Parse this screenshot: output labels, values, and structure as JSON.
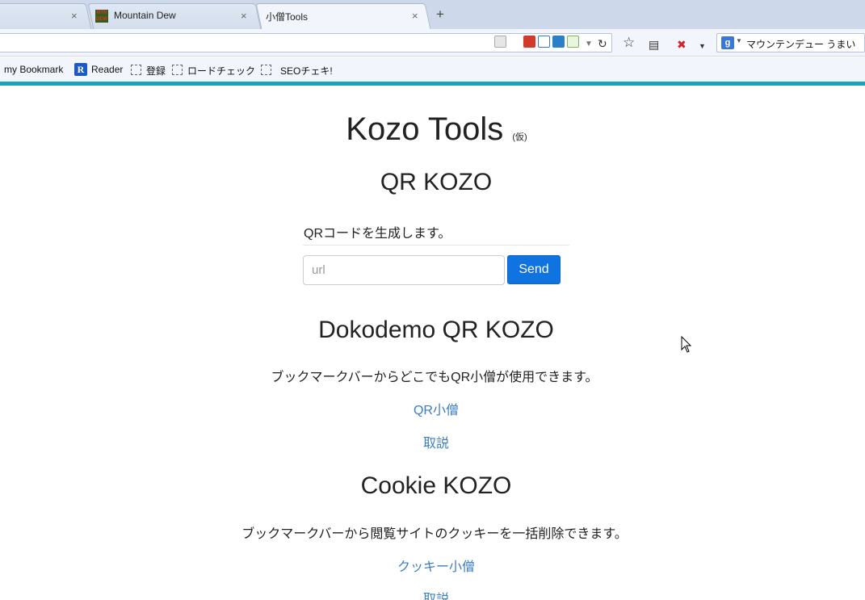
{
  "browser": {
    "tabs": [
      {
        "title": ""
      },
      {
        "title": "Mountain Dew",
        "favicon_text": "MTN DEW"
      },
      {
        "title": "小僧Tools"
      }
    ],
    "new_tab_symbol": "+",
    "close_symbol": "×",
    "search": {
      "engine_icon": "g",
      "query": "マウンテンデュー うまい"
    },
    "bookmarks": [
      {
        "label": "my Bookmark"
      },
      {
        "label": "Reader",
        "icon": "R"
      },
      {
        "label": "登録"
      },
      {
        "label": "ロードチェック"
      },
      {
        "label": "SEOチェキ!"
      }
    ],
    "colors": {
      "accent_bar": "#1f9fc2",
      "chrome": "#cdd9ea"
    }
  },
  "page": {
    "title": "Kozo Tools",
    "title_note": "(仮)",
    "qr": {
      "heading": "QR KOZO",
      "description": "QRコードを生成します。",
      "input_placeholder": "url",
      "send_label": "Send"
    },
    "dokodemo": {
      "heading": "Dokodemo QR KOZO",
      "description": "ブックマークバーからどこでもQR小僧が使用できます。",
      "link_label": "QR小僧",
      "manual_label": "取説"
    },
    "cookie": {
      "heading": "Cookie KOZO",
      "description": "ブックマークバーから閲覧サイトのクッキーを一括削除できます。",
      "link_label": "クッキー小僧",
      "manual_label": "取説"
    },
    "colors": {
      "button": "#0f74e0",
      "link": "#3a7ec0"
    }
  }
}
